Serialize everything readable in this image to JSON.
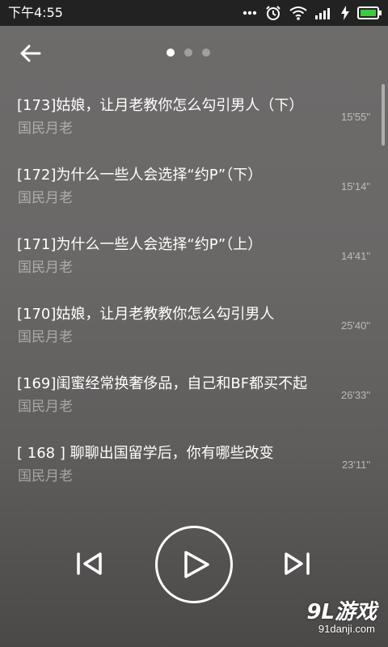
{
  "status_bar": {
    "time": "下午4:55",
    "icons": [
      "more-dots-icon",
      "alarm-icon",
      "wifi-icon",
      "signal-icon",
      "charging-icon",
      "battery-icon"
    ]
  },
  "header": {
    "page_count": 3,
    "active_page": 0
  },
  "episodes": [
    {
      "title": "[173]姑娘，让月老教你怎么勾引男人（下）",
      "author": "国民月老",
      "duration": "15'55\""
    },
    {
      "title": "[172]为什么一些人会选择“约P”（下）",
      "author": "国民月老",
      "duration": "15'14\""
    },
    {
      "title": "[171]为什么一些人会选择“约P”（上）",
      "author": "国民月老",
      "duration": "14'41\""
    },
    {
      "title": "[170]姑娘，让月老教教你怎么勾引男人",
      "author": "国民月老",
      "duration": "25'40\""
    },
    {
      "title": "[169]闺蜜经常换奢侈品，自己和BF都买不起",
      "author": "国民月老",
      "duration": "26'33\""
    },
    {
      "title": "[ 168 ] 聊聊出国留学后，你有哪些改变",
      "author": "国民月老",
      "duration": "23'11\""
    }
  ],
  "watermark": {
    "logo": "9L游戏",
    "url": "91danji.com"
  }
}
